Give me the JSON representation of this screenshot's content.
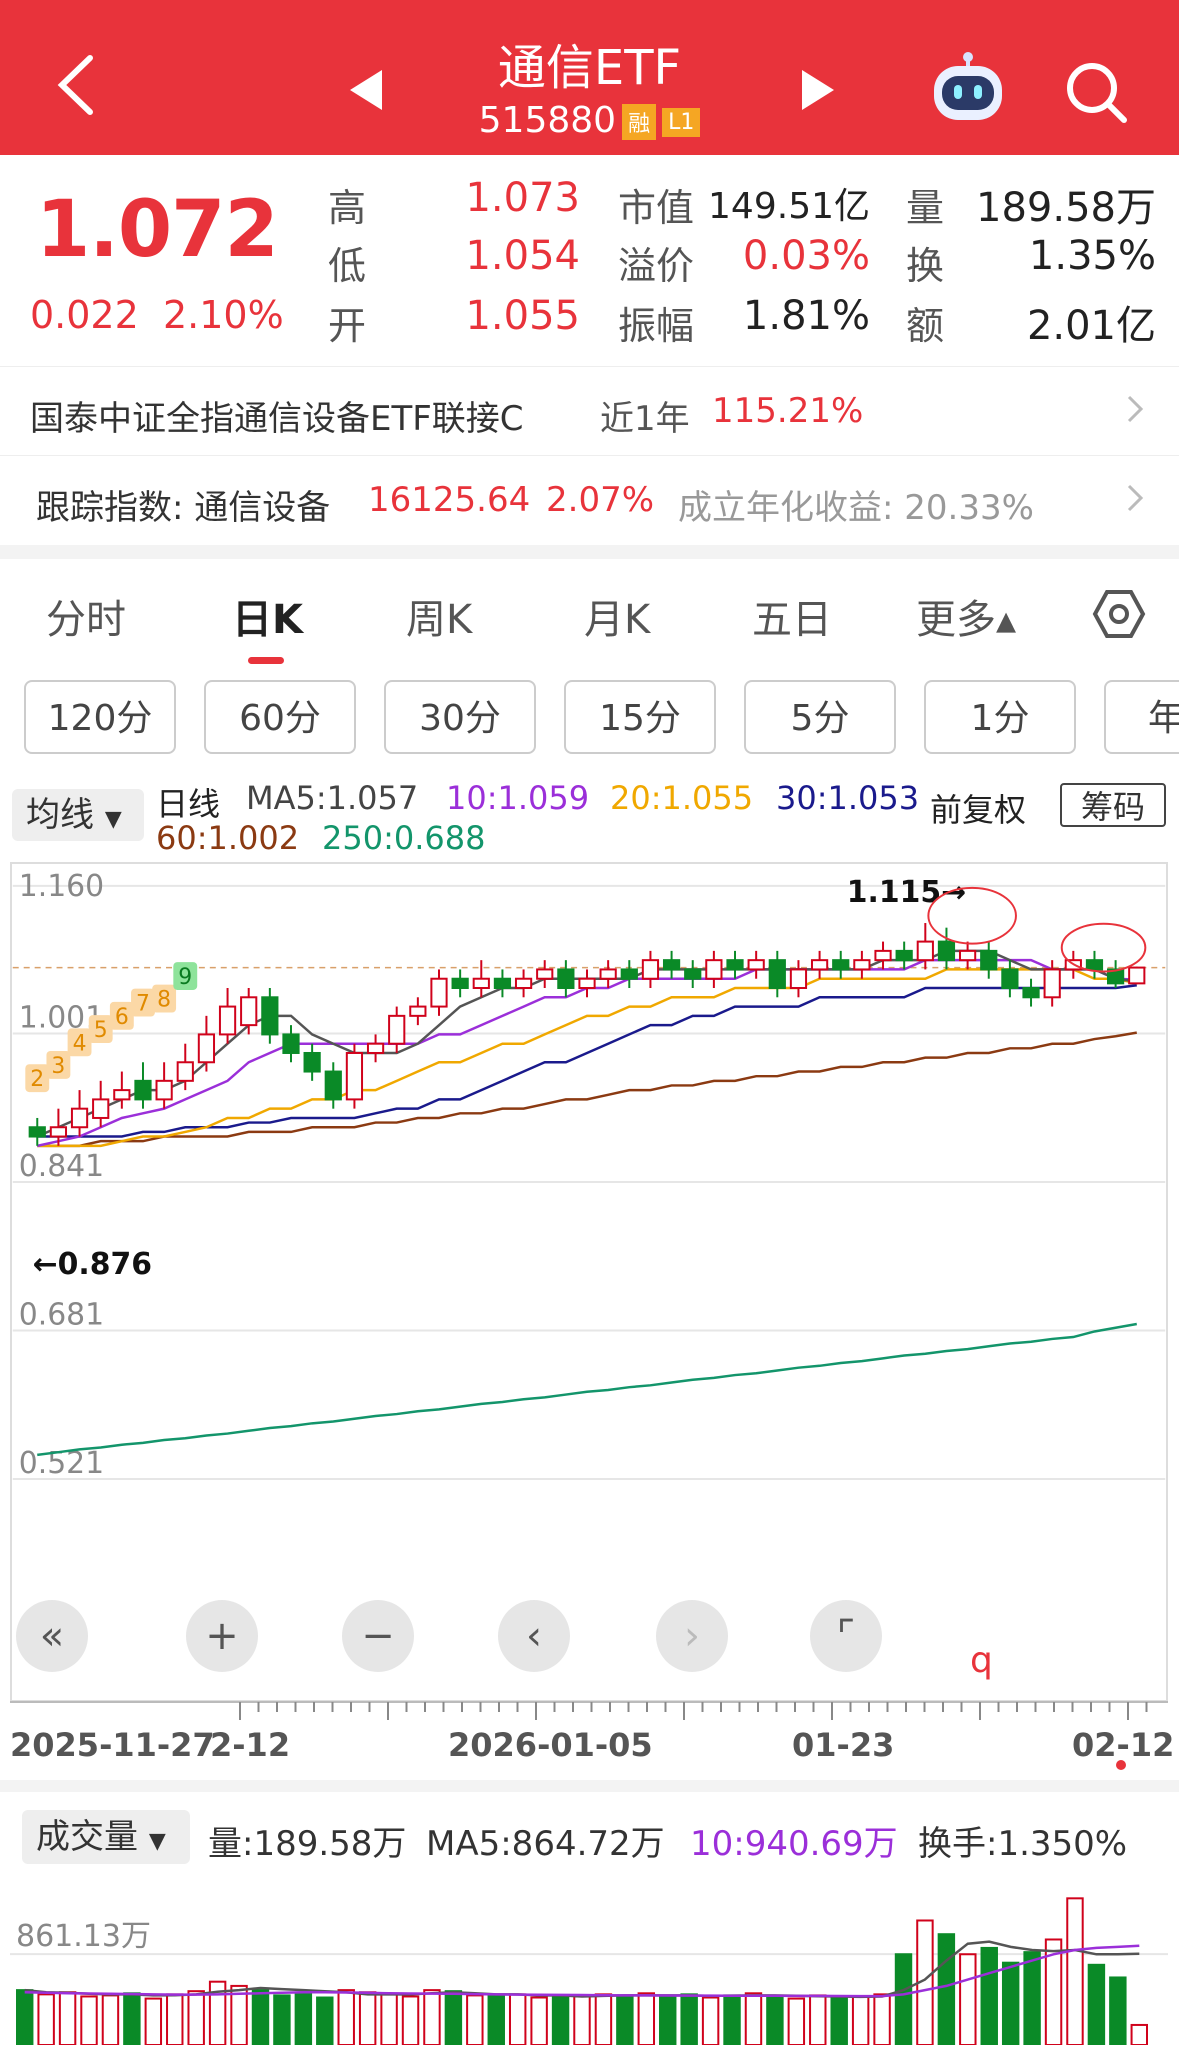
{
  "header": {
    "title": "通信ETF",
    "code": "515880",
    "badge_rong": "融",
    "badge_level": "L1"
  },
  "quote": {
    "price": "1.072",
    "change_abs": "0.022",
    "change_pct": "2.10%",
    "labels": {
      "high": "高",
      "low": "低",
      "open": "开",
      "mcap": "市值",
      "premium": "溢价",
      "amplitude": "振幅",
      "volume": "量",
      "turnover": "换",
      "amount": "额"
    },
    "high": "1.073",
    "low": "1.054",
    "open": "1.055",
    "mcap": "149.51亿",
    "premium": "0.03%",
    "amplitude": "1.81%",
    "volume": "189.58万",
    "turnover": "1.35%",
    "amount": "2.01亿"
  },
  "linked_fund": {
    "name": "国泰中证全指通信设备ETF联接C",
    "period": "近1年",
    "return": "115.21%"
  },
  "tracking": {
    "label": "跟踪指数: 通信设备",
    "value": "16125.64",
    "pct": "2.07%",
    "annual_label": "成立年化收益: 20.33%"
  },
  "tabs": [
    "分时",
    "日K",
    "周K",
    "月K",
    "五日",
    "更多▴"
  ],
  "period_buttons": [
    "120分",
    "60分",
    "30分",
    "15分",
    "5分",
    "1分",
    "年"
  ],
  "ma": {
    "selector": "均线",
    "line_type": "日线",
    "ma5": "MA5:1.057",
    "ma10": "10:1.059",
    "ma20": "20:1.055",
    "ma30": "30:1.053",
    "ma60": "60:1.002",
    "ma250": "250:0.688",
    "adjust": "前复权",
    "chip": "筹码"
  },
  "chart_data": {
    "type": "candlestick",
    "y_ticks": [
      "1.160",
      "1.001",
      "0.841",
      "0.681",
      "0.521"
    ],
    "ylim": [
      0.521,
      1.16
    ],
    "x_labels": [
      "2025-11-27",
      "2-12",
      "2026-01-05",
      "01-23",
      "02-12"
    ],
    "annotations": {
      "high": "1.115→",
      "low": "←0.876"
    },
    "td_numbers": [
      "2",
      "3",
      "4",
      "5",
      "6",
      "7",
      "8",
      "9"
    ],
    "candles": [
      [
        0.9,
        0.89,
        0.91,
        0.88
      ],
      [
        0.89,
        0.9,
        0.92,
        0.88
      ],
      [
        0.9,
        0.92,
        0.94,
        0.89
      ],
      [
        0.91,
        0.93,
        0.95,
        0.9
      ],
      [
        0.93,
        0.94,
        0.96,
        0.92
      ],
      [
        0.95,
        0.93,
        0.97,
        0.92
      ],
      [
        0.93,
        0.95,
        0.97,
        0.92
      ],
      [
        0.95,
        0.97,
        0.99,
        0.94
      ],
      [
        0.97,
        1.0,
        1.02,
        0.96
      ],
      [
        1.0,
        1.03,
        1.05,
        0.99
      ],
      [
        1.01,
        1.04,
        1.05,
        1.0
      ],
      [
        1.04,
        1.0,
        1.05,
        0.99
      ],
      [
        1.0,
        0.98,
        1.01,
        0.97
      ],
      [
        0.98,
        0.96,
        0.99,
        0.95
      ],
      [
        0.96,
        0.93,
        0.97,
        0.92
      ],
      [
        0.93,
        0.98,
        0.99,
        0.92
      ],
      [
        0.98,
        0.99,
        1.0,
        0.97
      ],
      [
        0.99,
        1.02,
        1.03,
        0.98
      ],
      [
        1.02,
        1.03,
        1.04,
        1.01
      ],
      [
        1.03,
        1.06,
        1.07,
        1.02
      ],
      [
        1.06,
        1.05,
        1.07,
        1.04
      ],
      [
        1.05,
        1.06,
        1.08,
        1.04
      ],
      [
        1.06,
        1.05,
        1.07,
        1.04
      ],
      [
        1.05,
        1.06,
        1.07,
        1.04
      ],
      [
        1.06,
        1.07,
        1.08,
        1.05
      ],
      [
        1.07,
        1.05,
        1.08,
        1.04
      ],
      [
        1.05,
        1.06,
        1.07,
        1.04
      ],
      [
        1.06,
        1.07,
        1.08,
        1.05
      ],
      [
        1.07,
        1.06,
        1.08,
        1.05
      ],
      [
        1.06,
        1.08,
        1.09,
        1.05
      ],
      [
        1.08,
        1.07,
        1.09,
        1.06
      ],
      [
        1.07,
        1.06,
        1.08,
        1.05
      ],
      [
        1.06,
        1.08,
        1.09,
        1.05
      ],
      [
        1.08,
        1.07,
        1.09,
        1.06
      ],
      [
        1.07,
        1.08,
        1.09,
        1.06
      ],
      [
        1.08,
        1.05,
        1.09,
        1.04
      ],
      [
        1.05,
        1.07,
        1.08,
        1.04
      ],
      [
        1.07,
        1.08,
        1.09,
        1.06
      ],
      [
        1.08,
        1.07,
        1.09,
        1.06
      ],
      [
        1.07,
        1.08,
        1.09,
        1.06
      ],
      [
        1.08,
        1.09,
        1.1,
        1.07
      ],
      [
        1.09,
        1.08,
        1.1,
        1.07
      ],
      [
        1.08,
        1.1,
        1.12,
        1.07
      ],
      [
        1.1,
        1.08,
        1.115,
        1.07
      ],
      [
        1.08,
        1.09,
        1.1,
        1.07
      ],
      [
        1.09,
        1.07,
        1.1,
        1.06
      ],
      [
        1.07,
        1.05,
        1.08,
        1.04
      ],
      [
        1.05,
        1.04,
        1.06,
        1.03
      ],
      [
        1.04,
        1.07,
        1.08,
        1.03
      ],
      [
        1.07,
        1.08,
        1.09,
        1.06
      ],
      [
        1.08,
        1.07,
        1.09,
        1.06
      ],
      [
        1.07,
        1.055,
        1.08,
        1.05
      ],
      [
        1.055,
        1.072,
        1.073,
        1.054
      ]
    ],
    "ma_lines": {
      "ma5": [
        0.89,
        0.9,
        0.91,
        0.92,
        0.93,
        0.94,
        0.94,
        0.95,
        0.97,
        0.99,
        1.01,
        1.02,
        1.02,
        1.0,
        0.99,
        0.98,
        0.98,
        0.98,
        0.99,
        1.01,
        1.03,
        1.04,
        1.05,
        1.05,
        1.06,
        1.06,
        1.06,
        1.06,
        1.06,
        1.07,
        1.07,
        1.07,
        1.07,
        1.07,
        1.07,
        1.07,
        1.07,
        1.07,
        1.07,
        1.07,
        1.08,
        1.08,
        1.08,
        1.09,
        1.09,
        1.09,
        1.08,
        1.07,
        1.07,
        1.07,
        1.07,
        1.06,
        1.057
      ],
      "ma10": [
        0.88,
        0.885,
        0.89,
        0.9,
        0.91,
        0.915,
        0.92,
        0.93,
        0.94,
        0.95,
        0.97,
        0.98,
        0.99,
        0.99,
        0.99,
        0.99,
        0.99,
        0.99,
        0.99,
        1.0,
        1.0,
        1.01,
        1.02,
        1.03,
        1.04,
        1.04,
        1.05,
        1.05,
        1.06,
        1.06,
        1.06,
        1.06,
        1.06,
        1.06,
        1.07,
        1.07,
        1.07,
        1.07,
        1.07,
        1.07,
        1.07,
        1.07,
        1.08,
        1.08,
        1.08,
        1.08,
        1.08,
        1.08,
        1.07,
        1.07,
        1.07,
        1.06,
        1.059
      ],
      "ma20": [
        0.88,
        0.88,
        0.88,
        0.88,
        0.885,
        0.89,
        0.89,
        0.895,
        0.9,
        0.91,
        0.91,
        0.92,
        0.92,
        0.93,
        0.93,
        0.94,
        0.94,
        0.95,
        0.96,
        0.97,
        0.97,
        0.98,
        0.99,
        0.99,
        1.0,
        1.01,
        1.02,
        1.02,
        1.03,
        1.03,
        1.04,
        1.04,
        1.04,
        1.05,
        1.05,
        1.05,
        1.05,
        1.06,
        1.06,
        1.06,
        1.06,
        1.06,
        1.06,
        1.07,
        1.07,
        1.07,
        1.07,
        1.07,
        1.07,
        1.07,
        1.06,
        1.06,
        1.055
      ],
      "ma30": [
        0.89,
        0.89,
        0.89,
        0.89,
        0.89,
        0.895,
        0.895,
        0.9,
        0.9,
        0.9,
        0.905,
        0.905,
        0.91,
        0.91,
        0.91,
        0.91,
        0.915,
        0.92,
        0.92,
        0.93,
        0.93,
        0.94,
        0.95,
        0.96,
        0.97,
        0.97,
        0.98,
        0.99,
        1.0,
        1.01,
        1.01,
        1.02,
        1.02,
        1.03,
        1.03,
        1.03,
        1.03,
        1.04,
        1.04,
        1.04,
        1.04,
        1.04,
        1.05,
        1.05,
        1.05,
        1.05,
        1.05,
        1.05,
        1.05,
        1.05,
        1.05,
        1.05,
        1.053
      ],
      "ma60": [
        0.88,
        0.88,
        0.88,
        0.885,
        0.885,
        0.885,
        0.89,
        0.89,
        0.89,
        0.89,
        0.895,
        0.895,
        0.895,
        0.9,
        0.9,
        0.9,
        0.905,
        0.905,
        0.91,
        0.91,
        0.915,
        0.915,
        0.92,
        0.92,
        0.925,
        0.93,
        0.93,
        0.935,
        0.94,
        0.94,
        0.945,
        0.945,
        0.95,
        0.95,
        0.955,
        0.955,
        0.96,
        0.96,
        0.965,
        0.965,
        0.97,
        0.97,
        0.975,
        0.975,
        0.98,
        0.98,
        0.985,
        0.985,
        0.99,
        0.99,
        0.995,
        0.998,
        1.002
      ],
      "ma250": [
        0.547,
        0.55,
        0.553,
        0.555,
        0.558,
        0.56,
        0.563,
        0.565,
        0.568,
        0.57,
        0.573,
        0.576,
        0.578,
        0.581,
        0.583,
        0.586,
        0.589,
        0.591,
        0.594,
        0.596,
        0.599,
        0.602,
        0.604,
        0.607,
        0.609,
        0.612,
        0.615,
        0.617,
        0.62,
        0.622,
        0.625,
        0.628,
        0.63,
        0.633,
        0.635,
        0.638,
        0.641,
        0.643,
        0.646,
        0.648,
        0.651,
        0.654,
        0.656,
        0.659,
        0.661,
        0.664,
        0.667,
        0.669,
        0.672,
        0.674,
        0.68,
        0.684,
        0.688
      ]
    }
  },
  "dates": {
    "d1": "2025-11-27",
    "d2": "2-12",
    "d3": "2026-01-05",
    "d4": "01-23",
    "d5": "02-12"
  },
  "volume": {
    "selector": "成交量",
    "vol": "量:189.58万",
    "ma5": "MA5:864.72万",
    "ma10": "10:940.69万",
    "turnover": "换手:1.350%",
    "y_label": "861.13万",
    "values": [
      520,
      480,
      500,
      460,
      470,
      490,
      440,
      480,
      510,
      600,
      560,
      520,
      470,
      480,
      450,
      520,
      500,
      480,
      460,
      520,
      510,
      470,
      460,
      480,
      450,
      470,
      460,
      480,
      470,
      490,
      460,
      480,
      450,
      470,
      490,
      460,
      440,
      470,
      450,
      460,
      480,
      860,
      1180,
      1050,
      860,
      920,
      780,
      880,
      1000,
      1390,
      760,
      640,
      190
    ],
    "ma5_values": [
      520,
      500,
      495,
      485,
      480,
      480,
      470,
      472,
      480,
      505,
      520,
      540,
      530,
      520,
      510,
      500,
      480,
      480,
      480,
      490,
      500,
      490,
      480,
      480,
      470,
      470,
      460,
      465,
      470,
      470,
      470,
      470,
      465,
      468,
      470,
      470,
      466,
      462,
      460,
      456,
      460,
      520,
      620,
      800,
      960,
      980,
      930,
      900,
      890,
      900,
      860,
      860,
      865
    ],
    "ma10_values": [
      500,
      495,
      490,
      488,
      485,
      483,
      480,
      478,
      478,
      480,
      485,
      490,
      495,
      500,
      500,
      498,
      495,
      490,
      488,
      487,
      485,
      482,
      480,
      478,
      476,
      475,
      474,
      472,
      470,
      470,
      469,
      468,
      468,
      467,
      466,
      466,
      465,
      465,
      464,
      463,
      463,
      480,
      520,
      560,
      620,
      680,
      740,
      800,
      860,
      900,
      920,
      930,
      941
    ]
  }
}
